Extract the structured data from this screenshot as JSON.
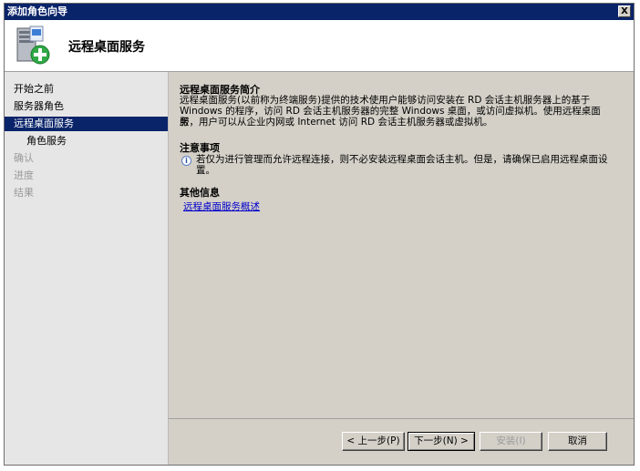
{
  "window": {
    "title": "添加角色向导",
    "close_label": "X"
  },
  "header": {
    "title": "远程桌面服务"
  },
  "nav": [
    {
      "label": "开始之前",
      "state": "normal"
    },
    {
      "label": "服务器角色",
      "state": "normal"
    },
    {
      "label": "远程桌面服务",
      "state": "active"
    },
    {
      "label": "角色服务",
      "state": "sub"
    },
    {
      "label": "确认",
      "state": "disabled"
    },
    {
      "label": "进度",
      "state": "disabled"
    },
    {
      "label": "结果",
      "state": "disabled"
    }
  ],
  "content": {
    "intro_title": "远程桌面服务简介",
    "intro_line1": "远程桌面服务(以前称为终端服务)提供的技术使用户能够访问安装在 RD 会话主机服务器上的基于",
    "intro_line2": "Windows 的程序，访问 RD 会话主机服务器的完整 Windows 桌面，或访问虚拟机。使用远程桌面服",
    "intro_line3": "务，用户可以从企业内网或 Internet 访问 RD 会话主机服务器或虚拟机。",
    "notes_title": "注意事项",
    "note_line1": "若仅为进行管理而允许远程连接，则不必安装远程桌面会话主机。但是，请确保已启用远程桌面设",
    "note_line2": "置。",
    "more_title": "其他信息",
    "more_link": "远程桌面服务概述"
  },
  "buttons": {
    "back": "< 上一步(P)",
    "next": "下一步(N) >",
    "install": "安装(I)",
    "cancel": "取消"
  }
}
